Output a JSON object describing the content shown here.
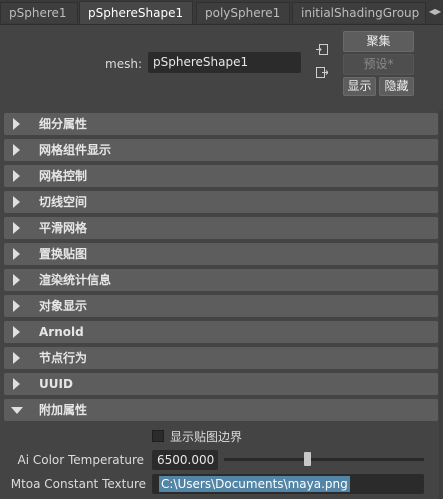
{
  "tabs": [
    "pSphere1",
    "pSphereShape1",
    "polySphere1",
    "initialShadingGroup"
  ],
  "mesh": {
    "label": "mesh:",
    "value": "pSphereShape1"
  },
  "buttons": {
    "focus": "聚集",
    "preset": "预设*",
    "show": "显示",
    "hide": "隐藏"
  },
  "sections": [
    "细分属性",
    "网格组件显示",
    "网格控制",
    "切线空间",
    "平滑网格",
    "置换贴图",
    "渲染统计信息",
    "对象显示",
    "Arnold",
    "节点行为",
    "UUID",
    "附加属性"
  ],
  "extra": {
    "checkbox_label": "显示贴图边界",
    "checkbox_checked": false,
    "color_temp_label": "Ai Color Temperature",
    "color_temp_value": "6500.000",
    "color_temp_slider_fraction": 0.42,
    "constant_texture_label": "Mtoa Constant Texture",
    "constant_texture_value": "C:\\Users\\Documents\\maya.png"
  }
}
